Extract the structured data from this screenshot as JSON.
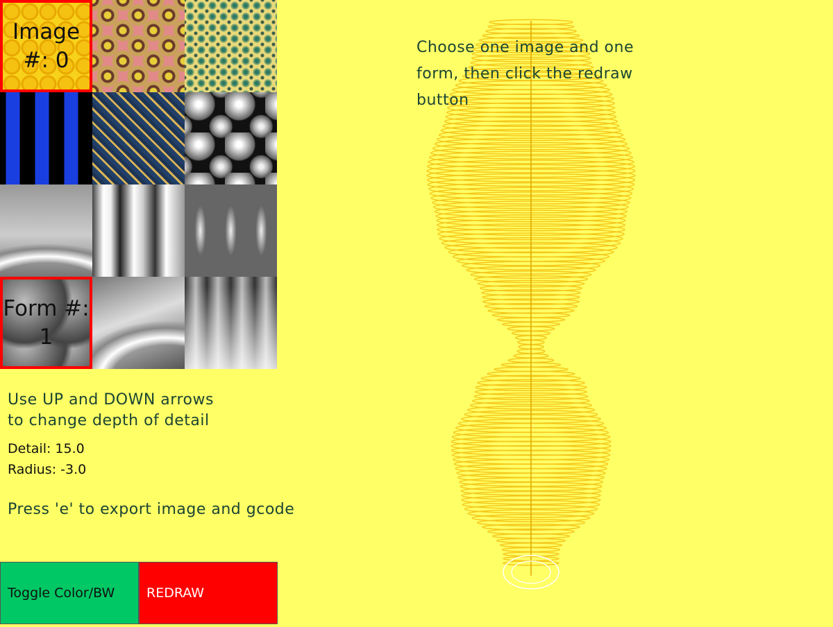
{
  "grid": {
    "tiles": [
      {
        "texture": "yellow-circles",
        "label_line1": "Image",
        "label_line2": "#: 0",
        "selected": true
      },
      {
        "texture": "pink-burst"
      },
      {
        "texture": "green-pattern"
      },
      {
        "texture": "blue-pillars"
      },
      {
        "texture": "diamond"
      },
      {
        "texture": "spheres"
      },
      {
        "texture": "gray-wave"
      },
      {
        "texture": "stripes"
      },
      {
        "texture": "ellipses"
      },
      {
        "texture": "form-1",
        "label_line1": "Form #:",
        "label_line2": "1",
        "selected": true
      },
      {
        "texture": "diag-wave"
      },
      {
        "texture": "vert-fade"
      }
    ]
  },
  "instructions": {
    "depth_line1": "Use UP and DOWN arrows",
    "depth_line2": "to change depth of detail",
    "export": "Press 'e' to export image and gcode",
    "choose_line1": "Choose one image and one",
    "choose_line2": "form, then click the redraw",
    "choose_line3": "button"
  },
  "values": {
    "detail": "Detail: 15.0",
    "radius": "Radius: -3.0"
  },
  "buttons": {
    "toggle": "Toggle Color/BW",
    "redraw": "REDRAW"
  },
  "colors": {
    "background": "#ffff66",
    "selection": "#ff0000",
    "toggle_button": "#00c864",
    "redraw_button": "#ff0000",
    "text_dark_green": "#1b4533",
    "vase": "#f5c518"
  }
}
